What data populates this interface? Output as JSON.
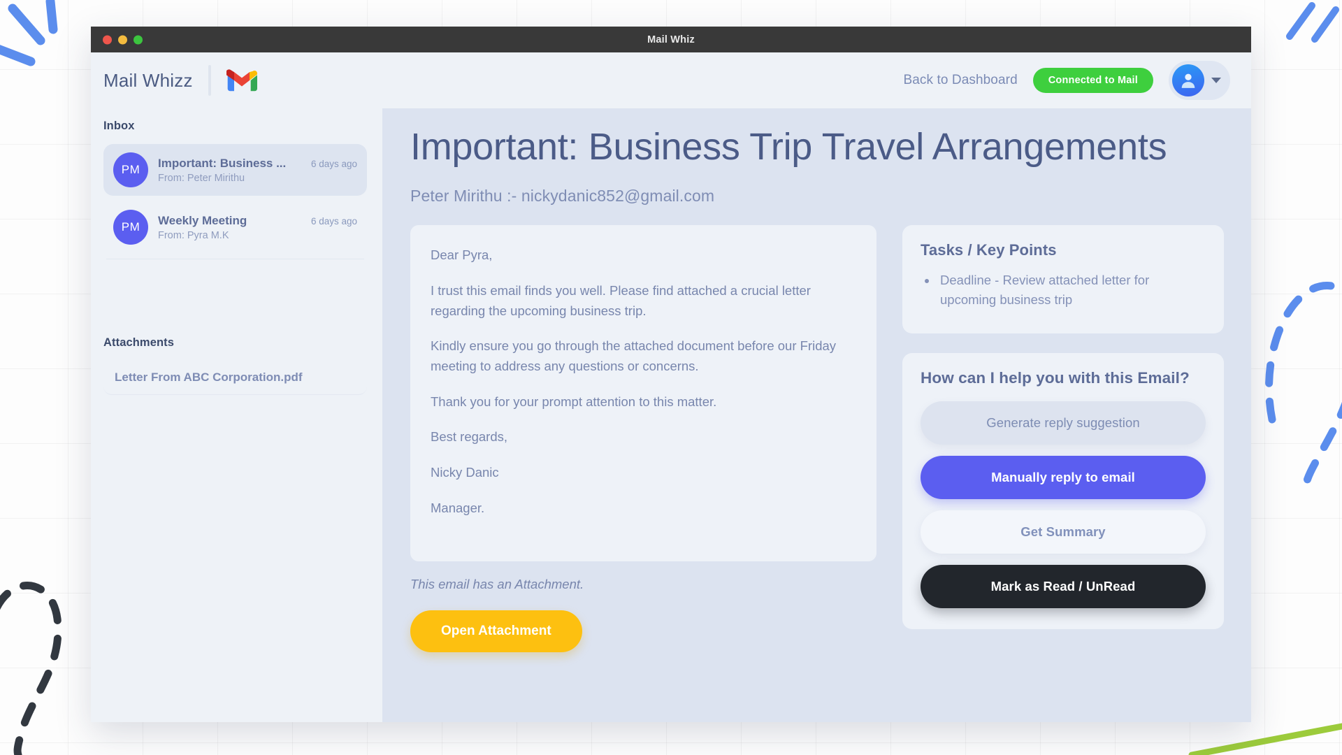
{
  "window": {
    "titlebar_title": "Mail Whiz",
    "traffic_lights": [
      "close-red",
      "minimize-yellow",
      "maximize-green"
    ]
  },
  "topbar": {
    "brand": "Mail Whizz",
    "logo_icon": "gmail-logo-icon",
    "back_to_dashboard": "Back to Dashboard",
    "connected_badge": "Connected to Mail",
    "avatar_icon": "user-avatar-icon",
    "caret_icon": "chevron-down-icon"
  },
  "sidebar": {
    "inbox_heading": "Inbox",
    "mails": [
      {
        "initials": "PM",
        "subject": "Important: Business ...",
        "time": "6 days ago",
        "from": "From: Peter Mirithu",
        "active": true
      },
      {
        "initials": "PM",
        "subject": "Weekly Meeting",
        "time": "6 days ago",
        "from": "From: Pyra M.K",
        "active": false
      }
    ],
    "attachments_heading": "Attachments",
    "attachments": [
      "Letter From ABC Corporation.pdf"
    ]
  },
  "main": {
    "email_title": "Important: Business Trip Travel Arrangements",
    "email_sender": "Peter Mirithu :- nickydanic852@gmail.com",
    "body_paragraphs": [
      "Dear Pyra,",
      "I trust this email finds you well. Please find attached a crucial letter regarding the upcoming business trip.",
      "Kindly ensure you go through the attached document before our Friday\nmeeting to address any questions or concerns.",
      "Thank you for your prompt attention to this matter.",
      "Best regards,",
      "Nicky Danic",
      "Manager."
    ],
    "attachment_note": "This email has an Attachment.",
    "open_attachment_label": "Open Attachment"
  },
  "tasks_panel": {
    "title": "Tasks / Key Points",
    "items": [
      "Deadline - Review attached letter for upcoming business trip"
    ]
  },
  "help_panel": {
    "title": "How can I help you with this Email?",
    "buttons": [
      {
        "label": "Generate reply suggestion",
        "style": "gray"
      },
      {
        "label": "Manually reply to email",
        "style": "primary"
      },
      {
        "label": "Get Summary",
        "style": "light"
      },
      {
        "label": "Mark as Read / UnRead",
        "style": "dark"
      }
    ]
  },
  "colors": {
    "titlebar": "#393939",
    "sidebar_bg": "#eef2f7",
    "main_bg": "#dce3f0",
    "accent_primary": "#5b5ef0",
    "accent_amber": "#fdc010",
    "accent_green": "#3ecf3e",
    "dark_button": "#22262c",
    "deco_blue": "#5b8ded",
    "deco_dark": "#323840",
    "deco_green": "#9ccb3b"
  }
}
